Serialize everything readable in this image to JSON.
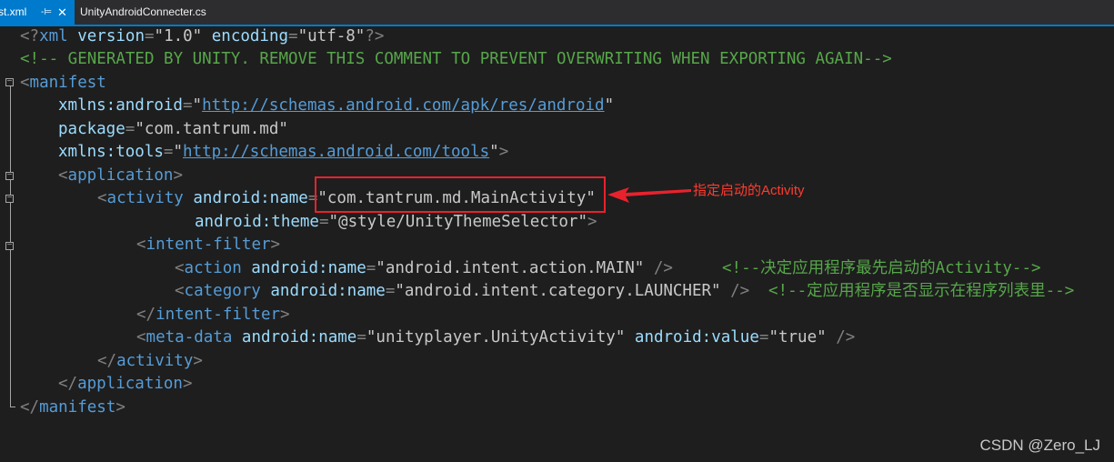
{
  "tabs": {
    "active": {
      "label": "st.xml",
      "pin_icon": "-⊨",
      "close_icon": "✕"
    },
    "inactive": {
      "label": "UnityAndroidConnecter.cs"
    }
  },
  "code": {
    "line1": {
      "lt": "<?",
      "tag": "xml",
      "a1": " version",
      "eq1": "=",
      "v1": "\"1.0\"",
      "a2": " encoding",
      "eq2": "=",
      "v2": "\"utf-8\"",
      "end": "?>"
    },
    "line2": {
      "text": "<!-- GENERATED BY UNITY. REMOVE THIS COMMENT TO PREVENT OVERWRITING WHEN EXPORTING AGAIN-->"
    },
    "line3": {
      "lt": "<",
      "tag": "manifest"
    },
    "line4": {
      "attr": "xmlns:android",
      "eq": "=",
      "q1": "\"",
      "url": "http://schemas.android.com/apk/res/android",
      "q2": "\""
    },
    "line5": {
      "attr": "package",
      "eq": "=",
      "val": "\"com.tantrum.md\""
    },
    "line6": {
      "attr": "xmlns:tools",
      "eq": "=",
      "q1": "\"",
      "url": "http://schemas.android.com/tools",
      "q2": "\"",
      "gt": ">"
    },
    "line7": {
      "lt": "<",
      "tag": "application",
      "gt": ">"
    },
    "line8": {
      "lt": "<",
      "tag": "activity",
      "attr": " android:name",
      "eq": "=",
      "val": "\"com.tantrum.md.MainActivity\""
    },
    "line9": {
      "attr": "android:theme",
      "eq": "=",
      "val": "\"@style/UnityThemeSelector\"",
      "gt": ">"
    },
    "line10": {
      "lt": "<",
      "tag": "intent-filter",
      "gt": ">"
    },
    "line11": {
      "lt": "<",
      "tag": "action",
      "attr": " android:name",
      "eq": "=",
      "val": "\"android.intent.action.MAIN\"",
      "end": " />",
      "comment": "<!--决定应用程序最先启动的Activity-->"
    },
    "line12": {
      "lt": "<",
      "tag": "category",
      "attr": " android:name",
      "eq": "=",
      "val": "\"android.intent.category.LAUNCHER\"",
      "end": " />",
      "comment": "<!--定应用程序是否显示在程序列表里-->"
    },
    "line13": {
      "lt": "</",
      "tag": "intent-filter",
      "gt": ">"
    },
    "line14": {
      "lt": "<",
      "tag": "meta-data",
      "attr1": " android:name",
      "eq1": "=",
      "val1": "\"unityplayer.UnityActivity\"",
      "attr2": " android:value",
      "eq2": "=",
      "val2": "\"true\"",
      "end": " />"
    },
    "line15": {
      "lt": "</",
      "tag": "activity",
      "gt": ">"
    },
    "line16": {
      "lt": "</",
      "tag": "application",
      "gt": ">"
    },
    "line17": {
      "lt": "</",
      "tag": "manifest",
      "gt": ">"
    }
  },
  "annotation": {
    "text": "指定启动的Activity",
    "color": "#ff3b30"
  },
  "watermark": "CSDN @Zero_LJ",
  "colors": {
    "background": "#1e1e1e",
    "tag": "#569cd6",
    "attribute": "#9cdcfe",
    "string": "#c8c8c8",
    "comment": "#57a64a",
    "accent": "#007acc"
  }
}
